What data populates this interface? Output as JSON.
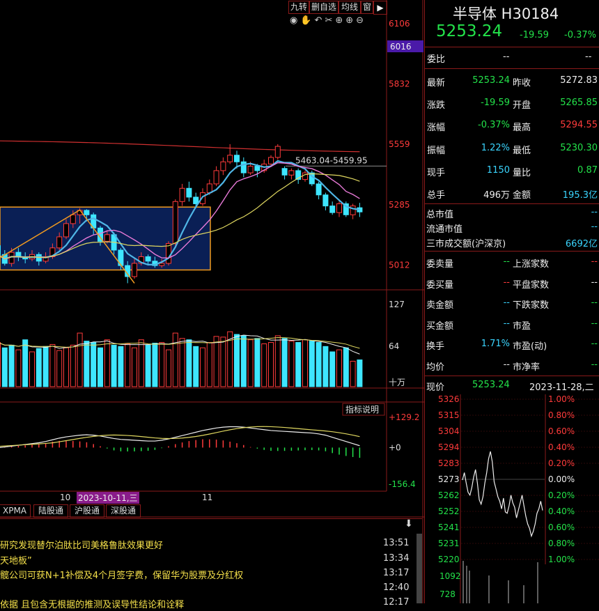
{
  "toolbar": {
    "btn1": "九转",
    "btn2": "删自选",
    "btn3": "均线",
    "btn4": "窗"
  },
  "chart_data": [
    {
      "type": "candlestick",
      "price_axis_labels": [
        "6106",
        "5832",
        "5559",
        "5285",
        "5012"
      ],
      "current_axis_label": "6016",
      "ylim": [
        4900,
        6150
      ],
      "annotation": "5463.04-5459.95",
      "candles": [
        {
          "o": 5100,
          "c": 5060,
          "h": 5120,
          "l": 5040
        },
        {
          "o": 5060,
          "c": 5020,
          "h": 5080,
          "l": 5010
        },
        {
          "o": 5020,
          "c": 5070,
          "h": 5090,
          "l": 5005
        },
        {
          "o": 5070,
          "c": 5050,
          "h": 5090,
          "l": 5030
        },
        {
          "o": 5050,
          "c": 5040,
          "h": 5070,
          "l": 5020
        },
        {
          "o": 5040,
          "c": 5060,
          "h": 5080,
          "l": 5030
        },
        {
          "o": 5060,
          "c": 5030,
          "h": 5070,
          "l": 5010
        },
        {
          "o": 5030,
          "c": 5050,
          "h": 5070,
          "l": 5020
        },
        {
          "o": 5050,
          "c": 5090,
          "h": 5110,
          "l": 5040
        },
        {
          "o": 5090,
          "c": 5140,
          "h": 5160,
          "l": 5080
        },
        {
          "o": 5140,
          "c": 5200,
          "h": 5220,
          "l": 5130
        },
        {
          "o": 5200,
          "c": 5240,
          "h": 5260,
          "l": 5180
        },
        {
          "o": 5240,
          "c": 5260,
          "h": 5270,
          "l": 5200
        },
        {
          "o": 5260,
          "c": 5240,
          "h": 5265,
          "l": 5210
        },
        {
          "o": 5240,
          "c": 5180,
          "h": 5250,
          "l": 5150
        },
        {
          "o": 5180,
          "c": 5120,
          "h": 5190,
          "l": 5100
        },
        {
          "o": 5120,
          "c": 5150,
          "h": 5170,
          "l": 5110
        },
        {
          "o": 5150,
          "c": 5080,
          "h": 5160,
          "l": 5060
        },
        {
          "o": 5080,
          "c": 5010,
          "h": 5090,
          "l": 4990
        },
        {
          "o": 5010,
          "c": 4960,
          "h": 5030,
          "l": 4930
        },
        {
          "o": 4960,
          "c": 5020,
          "h": 5040,
          "l": 4950
        },
        {
          "o": 5020,
          "c": 5050,
          "h": 5070,
          "l": 5010
        },
        {
          "o": 5050,
          "c": 5030,
          "h": 5060,
          "l": 5010
        },
        {
          "o": 5030,
          "c": 5010,
          "h": 5050,
          "l": 5000
        },
        {
          "o": 5010,
          "c": 5020,
          "h": 5040,
          "l": 5000
        },
        {
          "o": 5020,
          "c": 5110,
          "h": 5120,
          "l": 5010
        },
        {
          "o": 5110,
          "c": 5300,
          "h": 5310,
          "l": 5100
        },
        {
          "o": 5300,
          "c": 5360,
          "h": 5380,
          "l": 5280
        },
        {
          "o": 5360,
          "c": 5320,
          "h": 5390,
          "l": 5300
        },
        {
          "o": 5320,
          "c": 5290,
          "h": 5340,
          "l": 5270
        },
        {
          "o": 5290,
          "c": 5340,
          "h": 5360,
          "l": 5280
        },
        {
          "o": 5340,
          "c": 5380,
          "h": 5400,
          "l": 5330
        },
        {
          "o": 5380,
          "c": 5440,
          "h": 5460,
          "l": 5370
        },
        {
          "o": 5440,
          "c": 5480,
          "h": 5500,
          "l": 5420
        },
        {
          "o": 5480,
          "c": 5510,
          "h": 5560,
          "l": 5470
        },
        {
          "o": 5510,
          "c": 5480,
          "h": 5530,
          "l": 5450
        },
        {
          "o": 5480,
          "c": 5430,
          "h": 5500,
          "l": 5410
        },
        {
          "o": 5430,
          "c": 5460,
          "h": 5480,
          "l": 5420
        },
        {
          "o": 5460,
          "c": 5440,
          "h": 5470,
          "l": 5410
        },
        {
          "o": 5440,
          "c": 5470,
          "h": 5490,
          "l": 5430
        },
        {
          "o": 5470,
          "c": 5500,
          "h": 5510,
          "l": 5460
        },
        {
          "o": 5500,
          "c": 5550,
          "h": 5560,
          "l": 5490
        },
        {
          "o": 5450,
          "c": 5420,
          "h": 5460,
          "l": 5400
        },
        {
          "o": 5420,
          "c": 5440,
          "h": 5450,
          "l": 5400
        },
        {
          "o": 5440,
          "c": 5400,
          "h": 5450,
          "l": 5380
        },
        {
          "o": 5400,
          "c": 5430,
          "h": 5440,
          "l": 5390
        },
        {
          "o": 5430,
          "c": 5380,
          "h": 5440,
          "l": 5370
        },
        {
          "o": 5380,
          "c": 5330,
          "h": 5390,
          "l": 5310
        },
        {
          "o": 5330,
          "c": 5280,
          "h": 5340,
          "l": 5260
        },
        {
          "o": 5280,
          "c": 5250,
          "h": 5300,
          "l": 5240
        },
        {
          "o": 5250,
          "c": 5290,
          "h": 5300,
          "l": 5230
        },
        {
          "o": 5290,
          "c": 5240,
          "h": 5300,
          "l": 5230
        },
        {
          "o": 5240,
          "c": 5280,
          "h": 5290,
          "l": 5220
        },
        {
          "o": 5272,
          "c": 5253,
          "h": 5294,
          "l": 5230
        }
      ],
      "volume_axis_labels": [
        "127",
        "64",
        "十万"
      ],
      "volumes": [
        66,
        58,
        62,
        55,
        70,
        52,
        57,
        60,
        63,
        54,
        58,
        62,
        80,
        68,
        66,
        58,
        70,
        62,
        60,
        64,
        58,
        70,
        62,
        65,
        66,
        55,
        80,
        72,
        70,
        60,
        58,
        66,
        75,
        74,
        82,
        78,
        76,
        70,
        72,
        64,
        66,
        76,
        72,
        68,
        66,
        70,
        68,
        66,
        60,
        52,
        55,
        58,
        38,
        40
      ],
      "volume_colors": [
        "up",
        "down",
        "down",
        "up",
        "down",
        "up",
        "down",
        "down",
        "up",
        "up",
        "up",
        "up",
        "up",
        "down",
        "down",
        "down",
        "up",
        "down",
        "down",
        "up",
        "up",
        "up",
        "down",
        "down",
        "up",
        "up",
        "up",
        "up",
        "down",
        "down",
        "up",
        "up",
        "up",
        "up",
        "up",
        "down",
        "down",
        "up",
        "down",
        "up",
        "up",
        "up",
        "down",
        "up",
        "down",
        "up",
        "down",
        "down",
        "down",
        "down",
        "up",
        "down",
        "up",
        "down"
      ],
      "indicator_button": "指标说明",
      "indicator_axis_labels": [
        "+129.2",
        "+0",
        "-156.4"
      ],
      "macd": [
        10,
        14,
        18,
        22,
        26,
        30,
        34,
        40,
        48,
        56,
        62,
        66,
        70,
        72,
        70,
        66,
        60,
        54,
        50,
        48,
        46,
        44,
        42,
        42,
        46,
        52,
        60,
        68,
        76,
        84,
        92,
        98,
        104,
        108,
        110,
        110,
        108,
        104,
        100,
        96,
        92,
        90,
        88,
        86,
        84,
        82,
        80,
        76,
        70,
        60,
        50,
        40,
        30,
        20
      ],
      "x_tick_labels": [
        "10",
        "2023-10-11,三",
        "11"
      ]
    },
    {
      "type": "line",
      "title": "intraday",
      "price_labels": [
        "5326",
        "5315",
        "5304",
        "5294",
        "5283",
        "5273",
        "5262",
        "5252",
        "5241",
        "5231",
        "5220"
      ],
      "pct_labels": [
        "1.00%",
        "0.80%",
        "0.60%",
        "0.40%",
        "0.20%",
        "0.00%",
        "0.20%",
        "0.40%",
        "0.60%",
        "0.80%",
        "1.00%"
      ],
      "volume_labels": [
        "1092",
        "728"
      ],
      "ylim": [
        5220,
        5326
      ],
      "values": [
        5272,
        5278,
        5270,
        5265,
        5262,
        5268,
        5274,
        5280,
        5270,
        5260,
        5256,
        5262,
        5270,
        5278,
        5286,
        5292,
        5284,
        5272,
        5266,
        5262,
        5258,
        5254,
        5260,
        5252,
        5250,
        5256,
        5262,
        5258,
        5254,
        5248,
        5252,
        5258,
        5262,
        5256,
        5248,
        5244,
        5240,
        5236,
        5238,
        5244,
        5250,
        5254,
        5258,
        5253
      ]
    }
  ],
  "header": {
    "title": "半导体 H30184",
    "price": "5253.24",
    "change": "-19.59",
    "pct": "-0.37%"
  },
  "quote": {
    "weibi_label": "委比",
    "weibi_v1": "--",
    "weibi_v2": "--",
    "rows": [
      {
        "l1": "最新",
        "v1": "5253.24",
        "l2": "昨收",
        "v2": "5272.83"
      },
      {
        "l1": "涨跌",
        "v1": "-19.59",
        "l2": "开盘",
        "v2": "5265.85"
      },
      {
        "l1": "涨幅",
        "v1": "-0.37%",
        "l2": "最高",
        "v2": "5294.55"
      },
      {
        "l1": "振幅",
        "v1": "1.22%",
        "l2": "最低",
        "v2": "5230.30"
      },
      {
        "l1": "现手",
        "v1": "1150",
        "l2": "量比",
        "v2": "0.87"
      },
      {
        "l1": "总手",
        "v1": "496万",
        "l2": "金额",
        "v2": "195.3亿"
      }
    ],
    "market": [
      {
        "l": "总市值",
        "v": "--"
      },
      {
        "l": "流通市值",
        "v": "--"
      },
      {
        "l": "三市成交额(沪深京)",
        "v": "6692亿"
      }
    ],
    "rows2": [
      {
        "l1": "委卖量",
        "v1": "--",
        "l2": "上涨家数",
        "v2": "--"
      },
      {
        "l1": "委买量",
        "v1": "--",
        "l2": "平盘家数",
        "v2": "--"
      },
      {
        "l1": "卖金额",
        "v1": "--",
        "l2": "下跌家数",
        "v2": "--"
      },
      {
        "l1": "买金额",
        "v1": "--",
        "l2": "市盈",
        "v2": "--"
      },
      {
        "l1": "换手",
        "v1": "1.71%",
        "l2": "市盈(动)",
        "v2": "--"
      },
      {
        "l1": "均价",
        "v1": "--",
        "l2": "市净率",
        "v2": "--"
      }
    ],
    "intraday_label": "现价",
    "intraday_price": "5253.24",
    "intraday_date": "2023-11-28,二"
  },
  "tabs": [
    "XPMA",
    "陆股通",
    "沪股通",
    "深股通"
  ],
  "news": [
    {
      "text": "研究发现替尔泊肽比司美格鲁肽效果更好",
      "time": "13:51"
    },
    {
      "text": "天地板”",
      "time": "13:34"
    },
    {
      "text": "髋公司可获N+1补偿及4个月签字费，保留华为股票及分红权",
      "time": "13:17"
    },
    {
      "text": "",
      "time": "12:40"
    },
    {
      "text": "依据 且包含无根据的推测及误导性结论和诠释",
      "time": "12:17"
    }
  ],
  "colors": {
    "up": "#ff3b3b",
    "down": "#3ee6ff",
    "ma5": "#4fb6e6",
    "ma10": "#e87ad8",
    "ma20": "#e0d860",
    "ma60": "#d03030",
    "box": "#f09a20"
  }
}
